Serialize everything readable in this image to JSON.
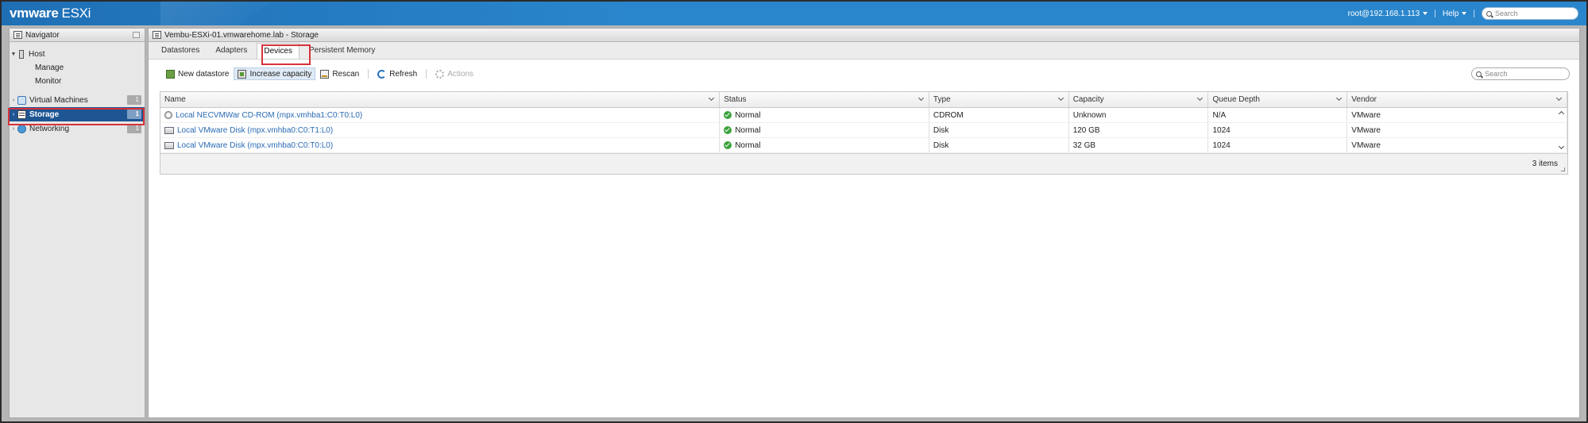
{
  "topbar": {
    "brand_vm": "vmware",
    "brand_product": "ESXi",
    "user": "root@192.168.1.113",
    "help": "Help",
    "search_placeholder": "Search"
  },
  "navigator": {
    "title": "Navigator",
    "items": [
      {
        "label": "Host",
        "badge": ""
      },
      {
        "label": "Manage",
        "badge": ""
      },
      {
        "label": "Monitor",
        "badge": ""
      },
      {
        "label": "Virtual Machines",
        "badge": "1"
      },
      {
        "label": "Storage",
        "badge": "1"
      },
      {
        "label": "Networking",
        "badge": "1"
      }
    ]
  },
  "main": {
    "title": "Vembu-ESXi-01.vmwarehome.lab - Storage",
    "tabs": [
      {
        "label": "Datastores"
      },
      {
        "label": "Adapters"
      },
      {
        "label": "Devices"
      },
      {
        "label": "Persistent Memory"
      }
    ],
    "toolbar": {
      "new_datastore": "New datastore",
      "increase_capacity": "Increase capacity",
      "rescan": "Rescan",
      "refresh": "Refresh",
      "actions": "Actions"
    },
    "search_placeholder": "Search"
  },
  "grid": {
    "columns": [
      "Name",
      "Status",
      "Type",
      "Capacity",
      "Queue Depth",
      "Vendor"
    ],
    "rows": [
      {
        "name": "Local NECVMWar CD-ROM (mpx.vmhba1:C0:T0:L0)",
        "status": "Normal",
        "type": "CDROM",
        "capacity": "Unknown",
        "queue": "N/A",
        "vendor": "VMware"
      },
      {
        "name": "Local VMware Disk (mpx.vmhba0:C0:T1:L0)",
        "status": "Normal",
        "type": "Disk",
        "capacity": "120 GB",
        "queue": "1024",
        "vendor": "VMware"
      },
      {
        "name": "Local VMware Disk (mpx.vmhba0:C0:T0:L0)",
        "status": "Normal",
        "type": "Disk",
        "capacity": "32 GB",
        "queue": "1024",
        "vendor": "VMware"
      }
    ],
    "footer_count": "3 items"
  },
  "colors": {
    "topbar": "#2a86cc",
    "selected_nav": "#1e5593",
    "highlight_box": "#d6333a",
    "status_ok": "#3ea33e",
    "link": "#2a6bb3"
  }
}
